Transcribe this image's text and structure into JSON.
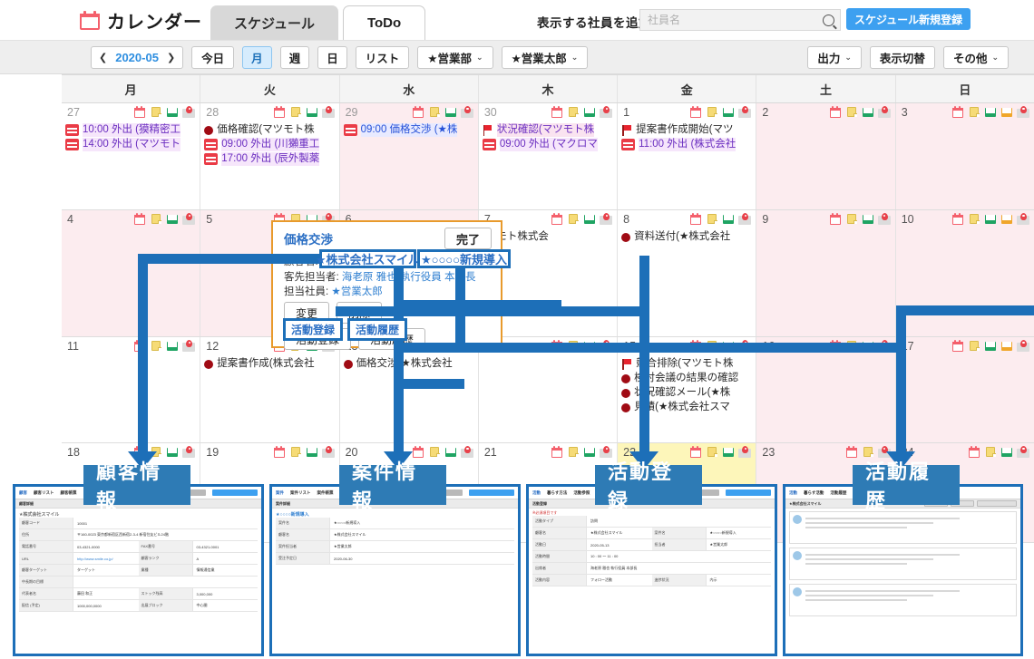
{
  "app": {
    "brand": "カレンダー",
    "brand_icon": "calendar-icon",
    "tabs": [
      {
        "label": "スケジュール",
        "selected": true
      },
      {
        "label": "ToDo",
        "selected": false
      }
    ],
    "add_employee_label": "表示する社員を追加",
    "search_placeholder": "社員名",
    "search_value": "",
    "search_icon": "search-icon",
    "new_schedule_button": "スケジュール新規登録",
    "accent": "#3da0f0"
  },
  "toolbar": {
    "prev": "❮",
    "date": "2020-05",
    "next": "❯",
    "today": "今日",
    "views": [
      {
        "label": "月",
        "active": true
      },
      {
        "label": "週",
        "active": false
      },
      {
        "label": "日",
        "active": false
      },
      {
        "label": "リスト",
        "active": false
      }
    ],
    "filters": [
      {
        "label": "★営業部",
        "caret": "⌄"
      },
      {
        "label": "★営業太郎",
        "caret": "⌄"
      }
    ],
    "right": [
      {
        "label": "出力",
        "caret": "⌄"
      },
      {
        "label": "表示切替",
        "caret": ""
      },
      {
        "label": "その他",
        "caret": "⌄"
      }
    ]
  },
  "calendar": {
    "dow": [
      "月",
      "火",
      "水",
      "木",
      "金",
      "土",
      "日"
    ],
    "day_icons": [
      "calendar-icon",
      "note-icon",
      "mail-icon",
      "pin-icon"
    ],
    "weeks": [
      {
        "days": [
          {
            "num": "27",
            "muted": true,
            "bg": "white",
            "icons": 4,
            "events": [
              {
                "icon": "event-icon",
                "style": "purple",
                "text": "10:00 外出 (獏精密工"
              },
              {
                "icon": "event-icon",
                "style": "purple",
                "text": "14:00 外出 (マツモト"
              }
            ]
          },
          {
            "num": "28",
            "muted": true,
            "bg": "white",
            "icons": 4,
            "events": [
              {
                "icon": "dot",
                "style": "plain",
                "text": "価格確認(マツモト株"
              },
              {
                "icon": "event-icon",
                "style": "purple",
                "text": "09:00 外出 (川獺重工"
              },
              {
                "icon": "event-icon",
                "style": "purple",
                "text": "17:00 外出 (辰外製薬"
              }
            ]
          },
          {
            "num": "29",
            "muted": true,
            "bg": "pink",
            "icons": 4,
            "events": [
              {
                "icon": "event-icon",
                "style": "blue",
                "text": "09:00 価格交渉 (★株"
              }
            ]
          },
          {
            "num": "30",
            "muted": true,
            "bg": "white",
            "icons": 4,
            "events": [
              {
                "icon": "flag",
                "style": "pinkbg",
                "text": "状況確認(マツモト株"
              },
              {
                "icon": "event-icon",
                "style": "purple",
                "text": "09:00 外出 (マクロマ"
              }
            ]
          },
          {
            "num": "1",
            "muted": false,
            "bg": "white",
            "icons": 4,
            "events": [
              {
                "icon": "flag",
                "style": "plain",
                "text": "提案書作成開始(マツ"
              },
              {
                "icon": "event-icon",
                "style": "purple",
                "text": "11:00 外出 (株式会社"
              }
            ]
          },
          {
            "num": "2",
            "muted": false,
            "bg": "pink",
            "icons": 4,
            "events": []
          },
          {
            "num": "3",
            "muted": false,
            "bg": "pink",
            "icons": 5,
            "events": []
          }
        ]
      },
      {
        "days": [
          {
            "num": "4",
            "muted": false,
            "bg": "pink",
            "icons": 4,
            "events": []
          },
          {
            "num": "5",
            "muted": false,
            "bg": "pink",
            "icons": 4,
            "events": []
          },
          {
            "num": "6",
            "muted": false,
            "bg": "pink",
            "icons": 0,
            "events": []
          },
          {
            "num": "7",
            "muted": false,
            "bg": "white",
            "icons": 4,
            "events": [
              {
                "icon": "none",
                "style": "plain",
                "text": "ツモト株式会"
              }
            ]
          },
          {
            "num": "8",
            "muted": false,
            "bg": "white",
            "icons": 4,
            "events": [
              {
                "icon": "dot",
                "style": "plain",
                "text": "資料送付(★株式会社"
              }
            ]
          },
          {
            "num": "9",
            "muted": false,
            "bg": "pink",
            "icons": 4,
            "events": []
          },
          {
            "num": "10",
            "muted": false,
            "bg": "pink",
            "icons": 5,
            "events": []
          }
        ]
      },
      {
        "days": [
          {
            "num": "11",
            "muted": false,
            "bg": "white",
            "icons": 4,
            "events": []
          },
          {
            "num": "12",
            "muted": false,
            "bg": "white",
            "icons": 4,
            "events": [
              {
                "icon": "dot",
                "style": "plain",
                "text": "提案書作成(株式会社"
              }
            ]
          },
          {
            "num": "13",
            "muted": false,
            "bg": "white",
            "icons": 4,
            "events": [
              {
                "icon": "dot",
                "style": "plain",
                "text": "価格交渉(★株式会社"
              }
            ]
          },
          {
            "num": "14",
            "muted": false,
            "bg": "white",
            "icons": 4,
            "events": []
          },
          {
            "num": "15",
            "muted": false,
            "bg": "white",
            "icons": 4,
            "events": [
              {
                "icon": "flag",
                "style": "plain",
                "text": "競合排除(マツモト株"
              },
              {
                "icon": "dot",
                "style": "plain",
                "text": "検討会議の結果の確認"
              },
              {
                "icon": "dot",
                "style": "plain",
                "text": "状況確認メール(★株"
              },
              {
                "icon": "dot",
                "style": "plain",
                "text": "見積(★株式会社スマ"
              }
            ]
          },
          {
            "num": "16",
            "muted": false,
            "bg": "pink",
            "icons": 4,
            "events": []
          },
          {
            "num": "17",
            "muted": false,
            "bg": "pink",
            "icons": 5,
            "events": []
          }
        ]
      },
      {
        "days": [
          {
            "num": "18",
            "muted": false,
            "bg": "white",
            "icons": 4,
            "events": []
          },
          {
            "num": "19",
            "muted": false,
            "bg": "white",
            "icons": 4,
            "events": []
          },
          {
            "num": "20",
            "muted": false,
            "bg": "white",
            "icons": 4,
            "events": []
          },
          {
            "num": "21",
            "muted": false,
            "bg": "white",
            "icons": 4,
            "events": []
          },
          {
            "num": "22",
            "muted": false,
            "bg": "yellow",
            "icons": 4,
            "events": []
          },
          {
            "num": "23",
            "muted": false,
            "bg": "pink",
            "icons": 3,
            "events": []
          },
          {
            "num": "24",
            "muted": false,
            "bg": "pink",
            "icons": 4,
            "events": []
          }
        ]
      }
    ]
  },
  "popup": {
    "title": "価格交渉",
    "done_button": "完了",
    "customer_label": "顧客名:",
    "contact_label": "客先担当者:",
    "contact_value": "海老原 雅也 執行役員 本部長",
    "staff_label": "担当社員:",
    "staff_value": "★営業太郎",
    "buttons_row1": [
      "変更",
      "削除"
    ],
    "buttons_row2": [
      "活動登録",
      "活動履歴"
    ]
  },
  "callouts": [
    {
      "name": "customer-callout",
      "text": "★株式会社スマイル"
    },
    {
      "name": "deal-callout",
      "text": "★○○○○新規導入"
    },
    {
      "name": "activity-register-callout",
      "text": "活動登録"
    },
    {
      "name": "activity-history-callout",
      "text": "活動履歴"
    }
  ],
  "annotations": [
    {
      "name": "customer-info-label",
      "text": "顧客情報"
    },
    {
      "name": "deal-info-label",
      "text": "案件情報"
    },
    {
      "name": "activity-register-label",
      "text": "活動登録"
    },
    {
      "name": "activity-history-label",
      "text": "活動履歴"
    }
  ],
  "thumbnails": [
    {
      "name": "customer-detail-screenshot",
      "tab_icon": "customer-icon",
      "tabs": [
        "顧客",
        "顧客リスト",
        "顧客帳票"
      ],
      "header_buttons": [
        "閉じる",
        "顧客情報の設定"
      ],
      "section": "顧客詳細",
      "entity": "★株式会社スマイル",
      "chips": [
        "ウォッチをはずす",
        "複製する",
        "顧客情報",
        "スケジュール (3)",
        "ToDo (1/4)",
        "帳票一覧",
        "活動一覧"
      ],
      "rows": [
        {
          "label": "顧客コード",
          "value": "10001"
        },
        {
          "label": "住所",
          "value": "〒160-0023 東京都新宿区西新宿2-3-4 新宿住友ビル24階",
          "link": "地図"
        },
        {
          "label": "電話番号",
          "value": "03-4321-0000",
          "label2": "FAX番号",
          "value2": "03-4321-0001"
        },
        {
          "label": "URL",
          "value": "http://www.smile.co.jp/",
          "link": true,
          "label2": "顧客ランク",
          "value2": "A"
        },
        {
          "label": "顧客ターゲット",
          "value": "ターゲット",
          "label2": "業種",
          "value2": "情報通信業"
        },
        {
          "label": "中長期の目標",
          "value": ""
        },
        {
          "label": "代表者名",
          "value": "藤田 和正",
          "label2": "ストック残高",
          "value2": "3,000,000"
        },
        {
          "label": "配信 (予定)",
          "value": "1000,000,0000",
          "label2": "出展ブロック",
          "value2": "中心圏"
        }
      ]
    },
    {
      "name": "deal-detail-screenshot",
      "tab_icon": "deal-icon",
      "tabs": [
        "案件",
        "案件リスト",
        "案件帳票"
      ],
      "header_buttons": [
        "閉じる",
        "案件情報の設定"
      ],
      "section": "案件詳細",
      "entity": "★○○○○新規導入",
      "chips": [
        "ウォッチする",
        "複製する",
        "案件情報",
        "スケジュール (2)",
        "ToDo (0)",
        "帳票一覧",
        "活動一覧"
      ],
      "rows": [
        {
          "label": "案件名",
          "value": "★○○○○新規導入"
        },
        {
          "label": "顧客名",
          "value": "★株式会社スマイル"
        },
        {
          "label": "案件担当者",
          "value": "★営業太郎"
        },
        {
          "label": "受注予定日",
          "value": "2020-06-30"
        }
      ]
    },
    {
      "name": "activity-register-screenshot",
      "tab_icon": "activity-icon",
      "tabs": [
        "活動",
        "暮らす方法",
        "活動参照"
      ],
      "header_buttons": [
        "閉じる",
        "保存"
      ],
      "section": "活動登録",
      "required_note": "※必須項目です",
      "rows": [
        {
          "label": "活動タイプ",
          "value": "訪問"
        },
        {
          "label": "顧客名",
          "value": "★株式会社スマイル",
          "label2": "案件名",
          "value2": "★○○○○新規導入"
        },
        {
          "label": "活動日",
          "value": "2020-05-13",
          "label2": "担当者",
          "value2": "★営業太郎"
        },
        {
          "label": "活動時間",
          "value": "10 : 00 〜 11 : 00"
        },
        {
          "label": "出席者",
          "value": "海老原 雅也 執行役員 本部長"
        },
        {
          "label": "活動内容",
          "value": "フォロー活動",
          "label2": "進捗状況",
          "value2": "内示"
        }
      ]
    },
    {
      "name": "activity-history-screenshot",
      "tab_icon": "activity-icon",
      "tabs": [
        "活動",
        "暮らす活動",
        "活動履歴"
      ],
      "header_buttons": [
        "活動登録",
        "リストカウント",
        "一覧表示項目設定"
      ],
      "section": "★株式会社スマイル",
      "rows": []
    }
  ]
}
